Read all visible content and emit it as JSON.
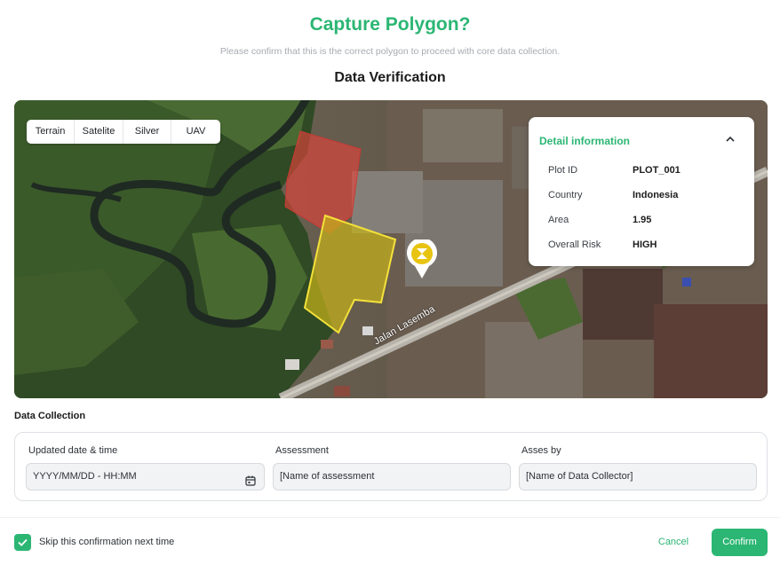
{
  "dialog": {
    "title": "Capture Polygon?",
    "subtitle": "Please confirm that this is the correct polygon to proceed with core data collection.",
    "section_title": "Data Verification"
  },
  "map": {
    "layer_tabs": [
      "Terrain",
      "Satelite",
      "Silver",
      "UAV"
    ],
    "road_label": "Jalan Lasemba",
    "marker_icon": "location-pin-icon",
    "colors": {
      "existing_polygon": "#e0443c",
      "captured_polygon": "#e8d21b"
    }
  },
  "detail": {
    "title": "Detail information",
    "toggle_icon": "chevron-up-icon",
    "rows": [
      {
        "label": "Plot ID",
        "value": "PLOT_001"
      },
      {
        "label": "Country",
        "value": "Indonesia"
      },
      {
        "label": "Area",
        "value": "1.95"
      },
      {
        "label": "Overall Risk",
        "value": "HIGH"
      }
    ]
  },
  "data_collection": {
    "title": "Data Collection",
    "fields": [
      {
        "label": "Updated date & time",
        "value": "YYYY/MM/DD - HH:MM",
        "icon": "calendar-icon"
      },
      {
        "label": "Assessment",
        "value": "[Name of assessment"
      },
      {
        "label": "Asses by",
        "value": "[Name of Data Collector]"
      }
    ]
  },
  "footer": {
    "skip_label": "Skip this confirmation next time",
    "skip_checked": true,
    "cancel_label": "Cancel",
    "confirm_label": "Confirm"
  },
  "colors": {
    "accent": "#2bb673"
  }
}
